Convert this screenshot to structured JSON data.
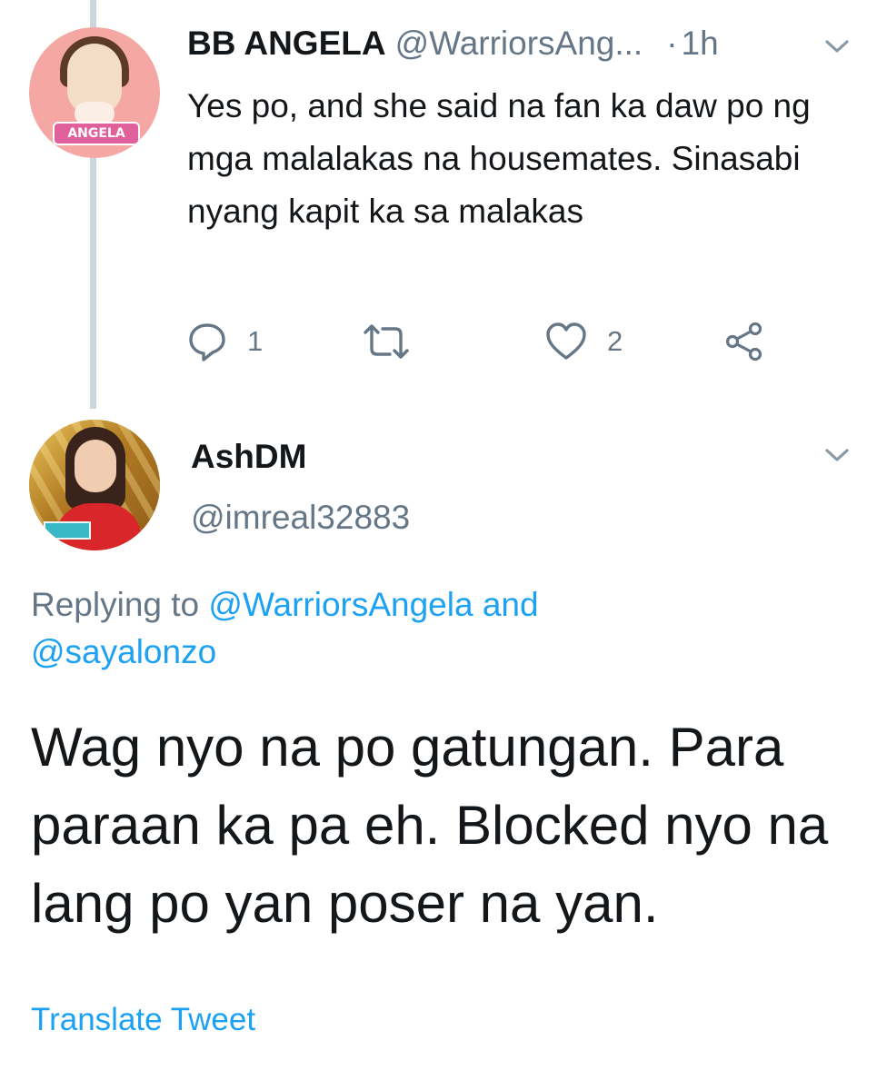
{
  "thread_reply": {
    "author_name": "BB ANGELA",
    "author_handle": "@WarriorsAng...",
    "separator": "·",
    "time": "1h",
    "avatar_label": "ANGELA",
    "text": "Yes po, and she said na fan ka daw po ng mga malalakas na housemates. Sinasabi nyang kapit ka sa malakas",
    "reply_count": "1",
    "like_count": "2"
  },
  "focused_tweet": {
    "author_name": "AshDM",
    "author_handle": "@imreal32883",
    "replying_prefix": "Replying to ",
    "replying_user_1": "@WarriorsAngela",
    "replying_and": " and ",
    "replying_user_2": "@sayalonzo",
    "text": "Wag nyo na po gatungan. Para paraan ka pa eh. Blocked nyo na lang po yan poser na yan.",
    "translate_label": "Translate Tweet"
  },
  "colors": {
    "link_blue": "#1da1f2",
    "secondary_gray": "#657786",
    "thread_line": "#ccd6dd",
    "avatar1_bg": "#f4a7a3"
  }
}
